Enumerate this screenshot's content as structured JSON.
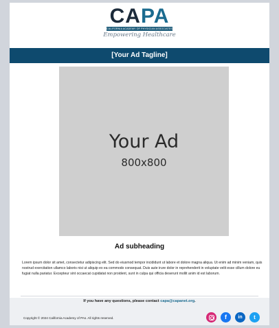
{
  "logo": {
    "wordmark_main": "CA",
    "wordmark_accent": "PA",
    "org_line": "CALIFORNIA ACADEMY OF PHYSICIAN ASSOCIATES",
    "tagline": "Empowering Healthcare"
  },
  "banner": {
    "tagline": "[Your Ad Tagline]"
  },
  "ad": {
    "title": "Your Ad",
    "size": "800x800"
  },
  "content": {
    "subheading": "Ad subheading",
    "body": "Lorem ipsum dolor sit amet, consectetur adipiscing elit. Sed do eiusmod tempor incididunt ut labore et dolore magna aliqua. Ut enim ad minim veniam, quis nostrud exercitation ullamco laboris nisi ut aliquip ex ea commodo consequat. Duis aute irure dolor in reprehenderit in voluptate velit esse cillum dolore eu fugiat nulla pariatur. Excepteur sint occaecat cupidatat non proident, sunt in culpa qui officia deserunt mollit anim id est laborum."
  },
  "footer": {
    "contact_prefix": "If you have any questions, please contact ",
    "contact_email": "capa@capanet.org",
    "contact_suffix": ".",
    "copyright": "Copyright © 2024 California Academy of PAs. All rights reserved.",
    "socials": [
      {
        "name": "instagram",
        "icon": "instagram-icon",
        "glyph": ""
      },
      {
        "name": "facebook",
        "icon": "facebook-icon",
        "glyph": "f"
      },
      {
        "name": "linkedin",
        "icon": "linkedin-icon",
        "glyph": "in"
      },
      {
        "name": "twitter",
        "icon": "twitter-icon",
        "glyph": "t"
      }
    ]
  },
  "colors": {
    "brand_navy": "#0e4a6e",
    "brand_teal": "#1b6b8f",
    "ad_placeholder": "#cfcfcf"
  }
}
